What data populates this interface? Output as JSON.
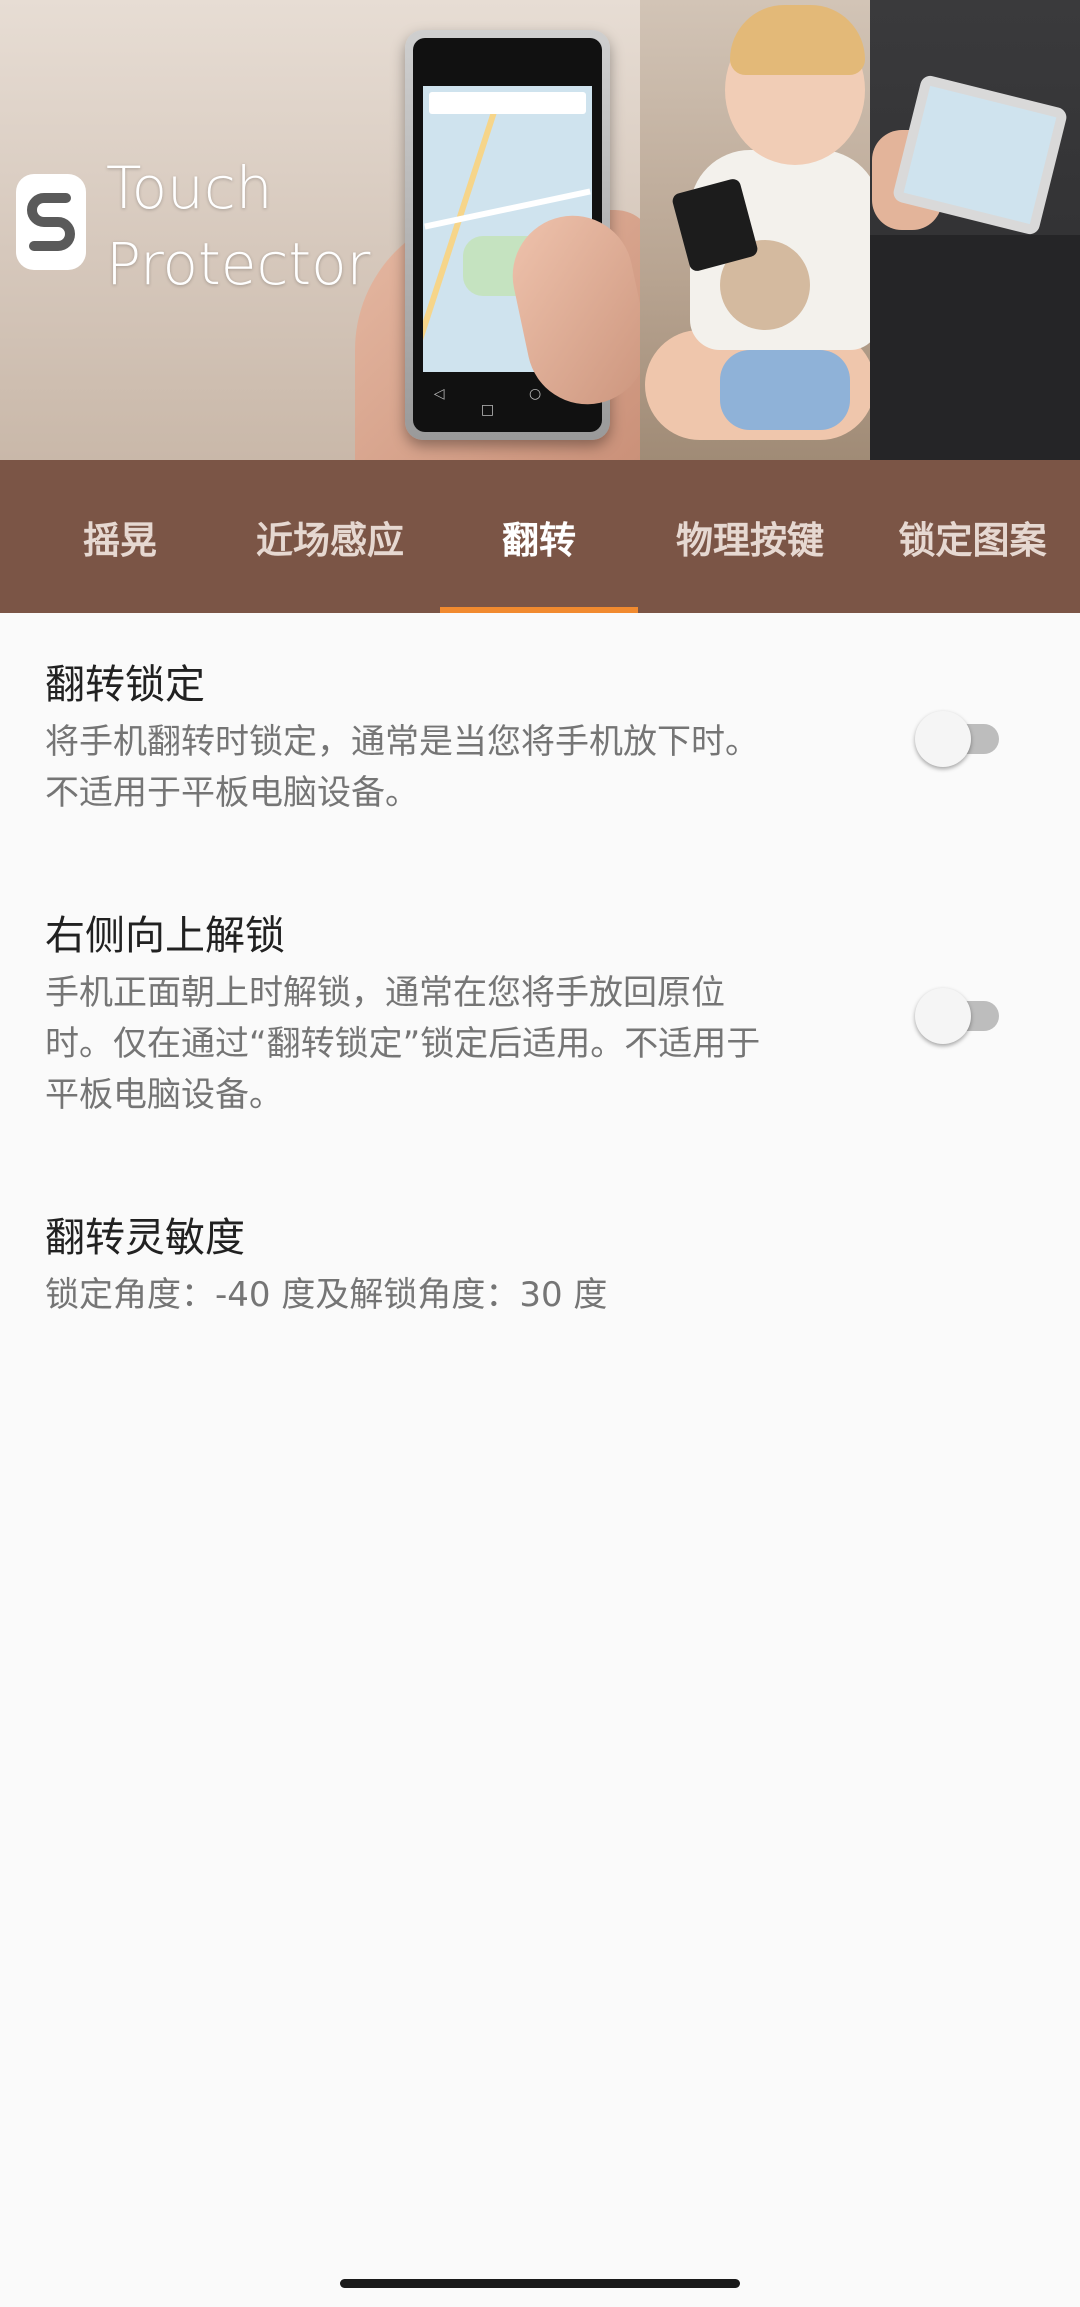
{
  "banner": {
    "logo_line1": "Touch",
    "logo_line2": "Protector"
  },
  "tabs": [
    {
      "label": "摇晃",
      "active": false
    },
    {
      "label": "近场感应",
      "active": false
    },
    {
      "label": "翻转",
      "active": true
    },
    {
      "label": "物理按键",
      "active": false
    },
    {
      "label": "锁定图案",
      "active": false
    }
  ],
  "settings": [
    {
      "title": "翻转锁定",
      "summary_lines": [
        "将手机翻转时锁定，通常是当您将手机放下时。",
        "不适用于平板电脑设备。"
      ],
      "toggle": false
    },
    {
      "title": "右侧向上解锁",
      "summary_lines": [
        "手机正面朝上时解锁，通常在您将手放回原位",
        "时。仅在通过“翻转锁定”锁定后适用。不适用于",
        "平板电脑设备。"
      ],
      "toggle": false
    },
    {
      "title": "翻转灵敏度",
      "summary_lines": [
        "锁定角度：-40 度及解锁角度：30 度"
      ]
    }
  ],
  "colors": {
    "tab_bar": "#7b5546",
    "tab_indicator": "#f18a2f",
    "background": "#fafafa"
  }
}
